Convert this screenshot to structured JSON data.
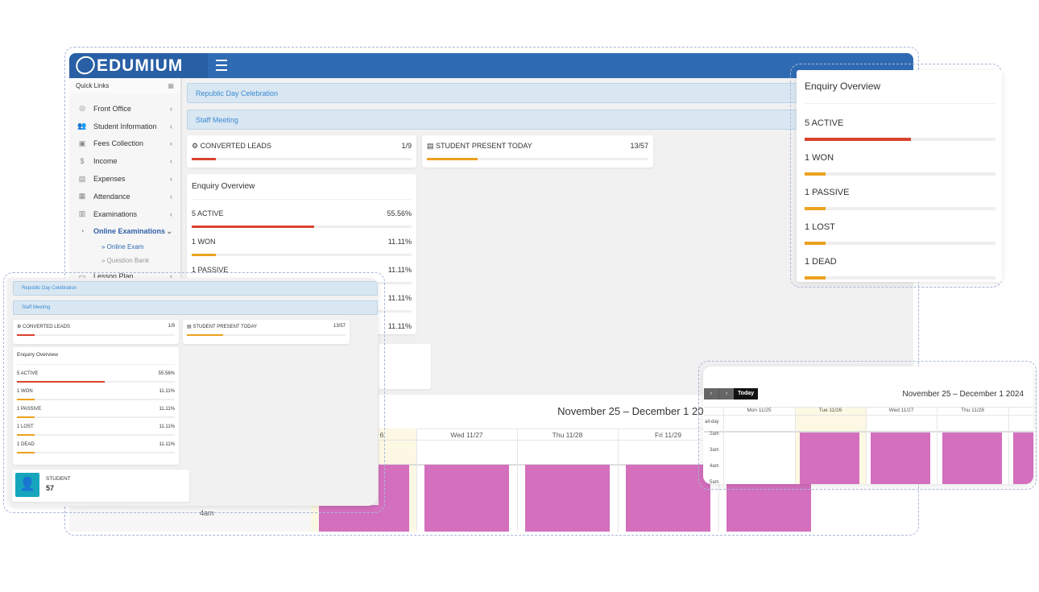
{
  "app": {
    "brand": "EDUMIUM",
    "colors": {
      "header": "#2f6bb3",
      "accent_red": "#d9432f",
      "accent_orange": "#eba21f",
      "event": "#d36fbd",
      "today": "#fcf8e3"
    }
  },
  "sidebar": {
    "quick_links": "Quick Links",
    "items": [
      {
        "label": "Front Office",
        "icon": "headset-icon"
      },
      {
        "label": "Student Information",
        "icon": "users-icon"
      },
      {
        "label": "Fees Collection",
        "icon": "money-icon"
      },
      {
        "label": "Income",
        "icon": "dollar-icon"
      },
      {
        "label": "Expenses",
        "icon": "credit-card-icon"
      },
      {
        "label": "Attendance",
        "icon": "calendar-check-icon"
      },
      {
        "label": "Examinations",
        "icon": "map-icon"
      },
      {
        "label": "Online Examinations",
        "icon": "rss-icon",
        "active": true
      },
      {
        "label": "Lesson Plan",
        "icon": "book-icon"
      }
    ],
    "subitems": [
      {
        "label": "Online Exam",
        "active": true
      },
      {
        "label": "Question Bank"
      }
    ]
  },
  "banners": [
    "Republic Day Celebration",
    "Staff Meeting"
  ],
  "stats": {
    "converted": {
      "label": "CONVERTED LEADS",
      "value": "1/9",
      "fraction": 0.111
    },
    "present": {
      "label": "STUDENT PRESENT TODAY",
      "value": "13/57",
      "fraction": 0.228
    }
  },
  "enquiry": {
    "title": "Enquiry Overview",
    "items": [
      {
        "label": "5 ACTIVE",
        "pct": "55.56%",
        "fraction": 0.5556,
        "color": "#d9432f"
      },
      {
        "label": "1 WON",
        "pct": "11.11%",
        "fraction": 0.1111,
        "color": "#eba21f"
      },
      {
        "label": "1 PASSIVE",
        "pct": "11.11%",
        "fraction": 0.1111,
        "color": "#eba21f"
      },
      {
        "label": "1 LOST",
        "pct": "11.11%",
        "fraction": 0.1111,
        "color": "#eba21f"
      },
      {
        "label": "1 DEAD",
        "pct": "11.11%",
        "fraction": 0.1111,
        "color": "#eba21f"
      }
    ]
  },
  "student": {
    "label": "STUDENT",
    "value": "57"
  },
  "calendar": {
    "title": "November 25 – December 1 2024",
    "today_btn": "Today",
    "all_day": "all-day",
    "days": [
      "Mon 11/25",
      "Tue 11/26",
      "Wed 11/27",
      "Thu 11/28",
      "Fri 11/29"
    ],
    "times": [
      "2am",
      "3am",
      "4am",
      "5am"
    ]
  }
}
